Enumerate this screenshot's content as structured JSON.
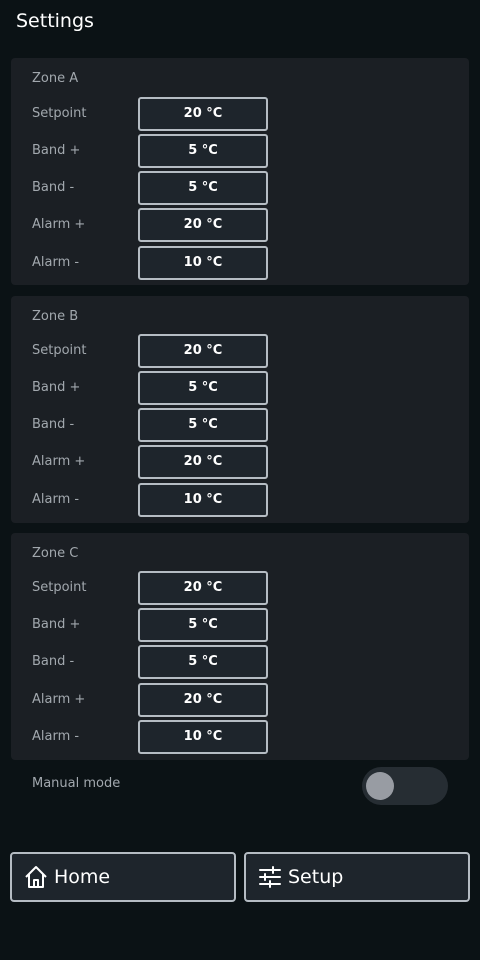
{
  "page": {
    "title": "Settings"
  },
  "row_labels": {
    "setpoint": "Setpoint",
    "band_plus": "Band +",
    "band_minus": "Band -",
    "alarm_plus": "Alarm +",
    "alarm_minus": "Alarm -"
  },
  "zones": [
    {
      "title": "Zone A",
      "setpoint": "20 °C",
      "band_plus": "5 °C",
      "band_minus": "5 °C",
      "alarm_plus": "20 °C",
      "alarm_minus": "10 °C"
    },
    {
      "title": "Zone B",
      "setpoint": "20 °C",
      "band_plus": "5 °C",
      "band_minus": "5 °C",
      "alarm_plus": "20 °C",
      "alarm_minus": "10 °C"
    },
    {
      "title": "Zone C",
      "setpoint": "20 °C",
      "band_plus": "5 °C",
      "band_minus": "5 °C",
      "alarm_plus": "20 °C",
      "alarm_minus": "10 °C"
    }
  ],
  "manual_mode": {
    "label": "Manual mode",
    "enabled": false
  },
  "nav": {
    "home": {
      "label": "Home",
      "icon": "home-icon"
    },
    "setup": {
      "label": "Setup",
      "icon": "sliders-icon"
    }
  },
  "colors": {
    "background": "#0b1215",
    "panel": "#1b1f24",
    "field_border": "#b5bcc3",
    "label": "#a2a8ae"
  }
}
